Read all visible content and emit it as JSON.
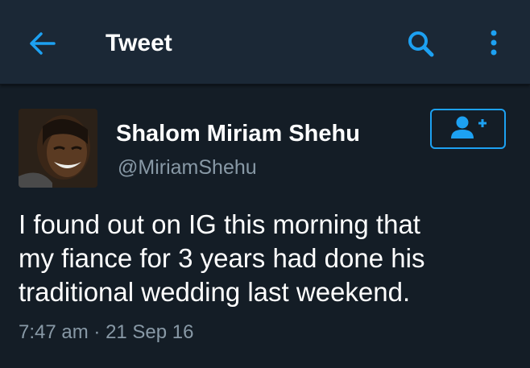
{
  "header": {
    "title": "Tweet",
    "back_icon": "arrow-left-icon",
    "search_icon": "search-icon",
    "more_icon": "more-vertical-icon"
  },
  "tweet": {
    "author": {
      "display_name": "Shalom Miriam Shehu",
      "username": "@MiriamShehu",
      "avatar": "profile-photo"
    },
    "follow_icon": "add-user-icon",
    "text_lines": [
      "I found out on IG this morning that",
      "my fiance for 3 years had done his",
      "traditional wedding last weekend."
    ],
    "time": "7:47 am",
    "separator": "·",
    "date": "21 Sep 16"
  },
  "colors": {
    "background": "#141d26",
    "header_background": "#1b2836",
    "accent": "#1da1f2",
    "secondary_text": "#8899a6"
  }
}
